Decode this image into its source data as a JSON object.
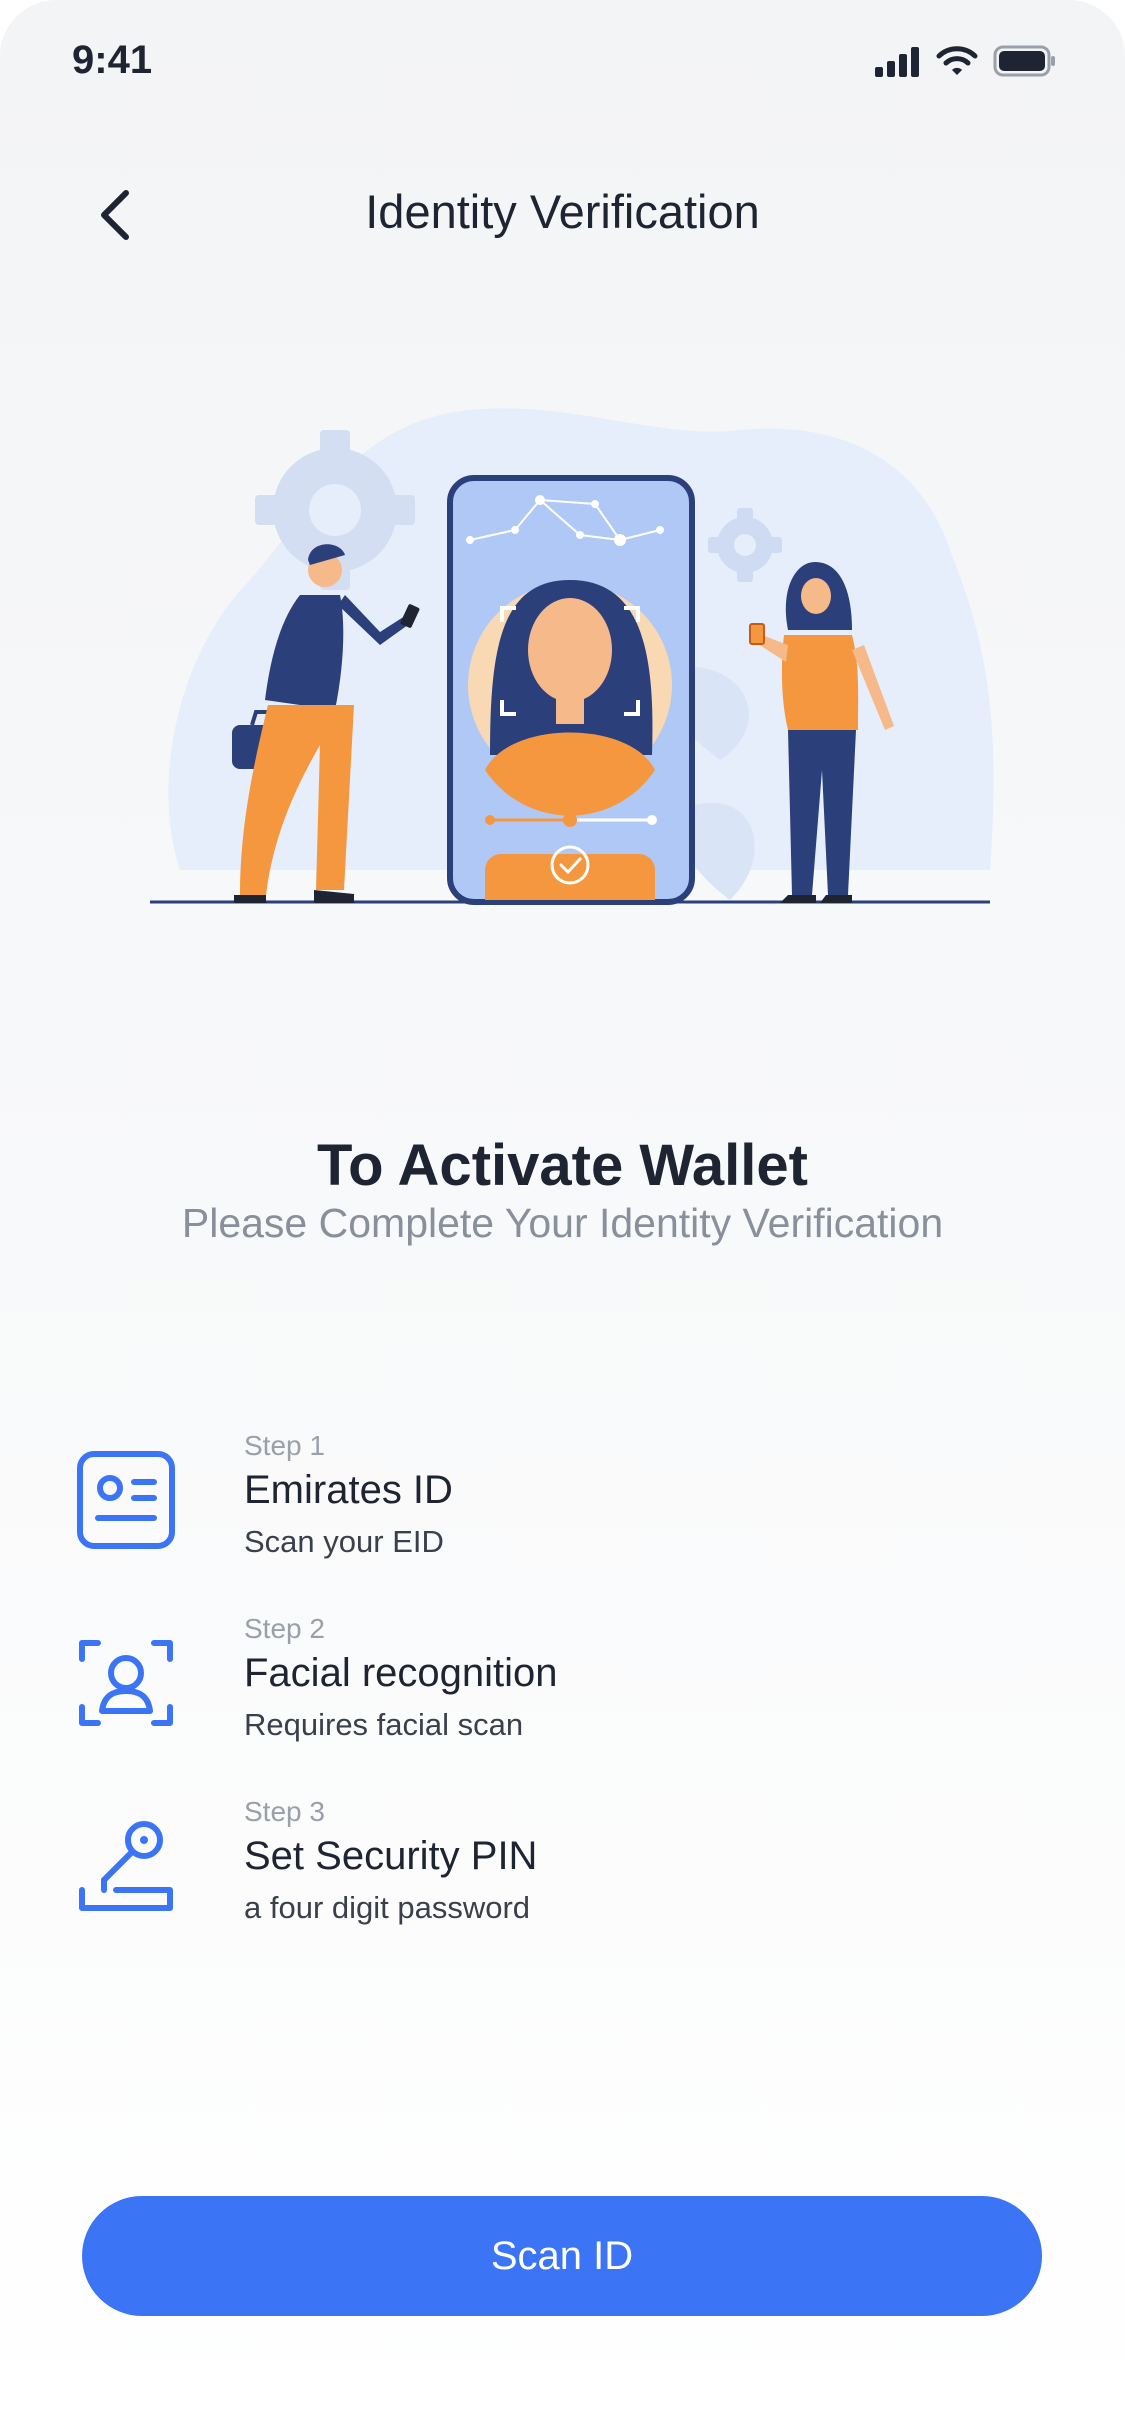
{
  "status_bar": {
    "time": "9:41",
    "icons": [
      "signal-icon",
      "wifi-icon",
      "battery-icon"
    ]
  },
  "header": {
    "back_icon": "chevron-left-icon",
    "title": "Identity Verification"
  },
  "illustration": {
    "description_icon": "identity-verification-illustration"
  },
  "intro": {
    "title": "To Activate Wallet",
    "subtitle": "Please Complete Your Identity Verification"
  },
  "steps": [
    {
      "number": "Step 1",
      "title": "Emirates ID",
      "description": "Scan your EID",
      "icon": "id-card-icon"
    },
    {
      "number": "Step 2",
      "title": "Facial recognition",
      "description": "Requires facial scan",
      "icon": "face-scan-icon"
    },
    {
      "number": "Step 3",
      "title": "Set Security PIN",
      "description": "a four digit password",
      "icon": "key-pin-icon"
    }
  ],
  "cta": {
    "label": "Scan ID"
  },
  "colors": {
    "accent": "#3B74F5",
    "text_primary": "#1F2433",
    "text_secondary": "#8A8F9C",
    "illustration_navy": "#2B3F7A",
    "illustration_orange": "#F5973F",
    "illustration_light_blue": "#AFC8F6"
  }
}
